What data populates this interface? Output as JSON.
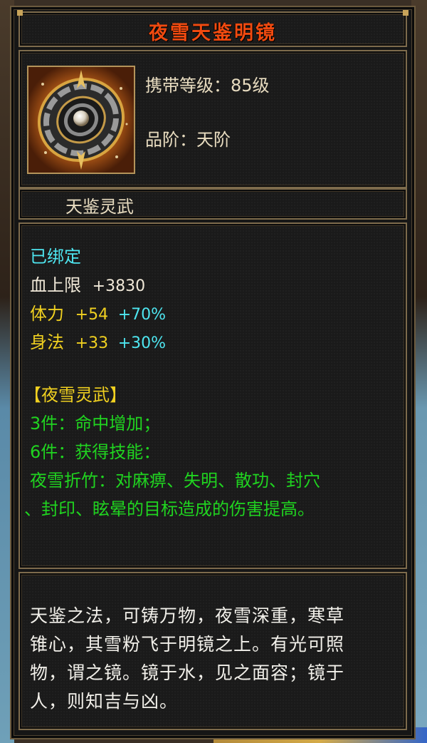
{
  "item": {
    "name": "夜雪天鉴明镜",
    "level_line": "携带等级：85级",
    "grade_line": "品阶：天阶",
    "icon": "mirror-shield-icon",
    "set_tag": "天鉴灵武"
  },
  "attributes": {
    "bound": "已绑定",
    "hp": {
      "label": "血上限",
      "value": "+3830"
    },
    "stamina": {
      "label": "体力",
      "value": "+54",
      "bonus": "+70%"
    },
    "agility": {
      "label": "身法",
      "value": "+33",
      "bonus": "+30%"
    }
  },
  "set": {
    "title": "【夜雪灵武】",
    "bonus3": "3件：命中增加；",
    "bonus6": "6件：获得技能：",
    "skill_line1": "夜雪折竹：对麻痹、失明、散功、封穴",
    "skill_line2": "、封印、眩晕的目标造成的伤害提高。"
  },
  "description": {
    "line1": "天鉴之法，可铸万物，夜雪深重，寒草",
    "line2": "锥心，其雪粉飞于明镜之上。有光可照",
    "line3": "物，谓之镜。镜于水，见之面容；镜于",
    "line4": "人，则知吉与凶。"
  },
  "colors": {
    "title": "#f04a10",
    "bound": "#4ee6f0",
    "base_attr": "#f0d020",
    "bonus_percent": "#4ee6f0",
    "set_text": "#20d420",
    "set_title": "#f0d020"
  }
}
